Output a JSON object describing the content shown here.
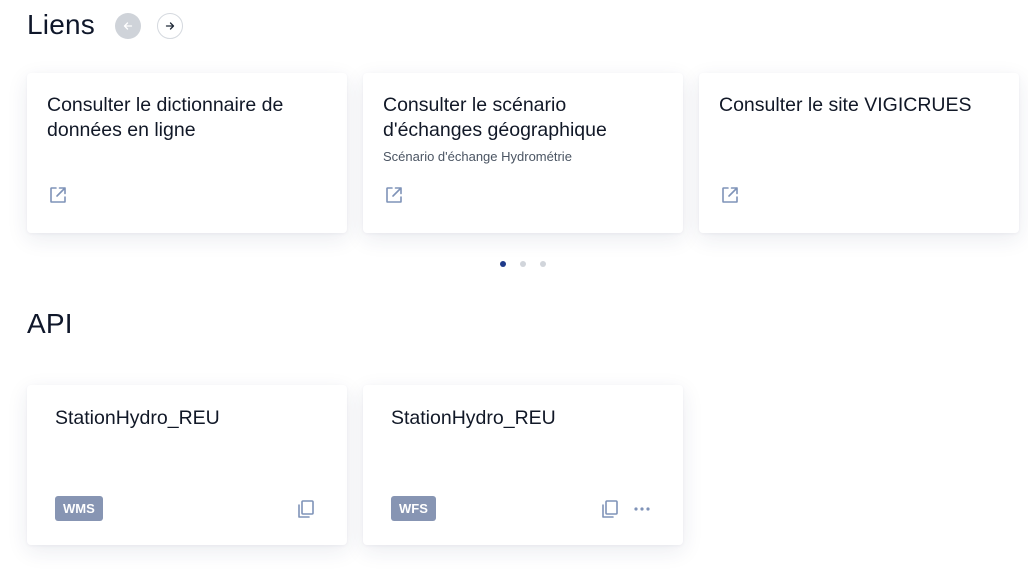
{
  "links_section": {
    "title": "Liens",
    "prev_icon": "arrow-left-icon",
    "next_icon": "arrow-right-icon",
    "cards": [
      {
        "title": "Consulter le dictionnaire de données en ligne",
        "subtitle": "",
        "icon": "external-link-icon"
      },
      {
        "title": "Consulter le scénario d'échanges géographique",
        "subtitle": "Scénario d'échange Hydrométrie",
        "icon": "external-link-icon"
      },
      {
        "title": "Consulter le site VIGICRUES",
        "subtitle": "",
        "icon": "external-link-icon"
      }
    ],
    "pagination": {
      "total": 3,
      "active": 1
    }
  },
  "api_section": {
    "title": "API",
    "cards": [
      {
        "title": "StationHydro_REU",
        "badge": "WMS",
        "icons": [
          "copy-icon"
        ]
      },
      {
        "title": "StationHydro_REU",
        "badge": "WFS",
        "icons": [
          "copy-icon",
          "more-icon"
        ]
      }
    ]
  },
  "colors": {
    "badge_bg": "#8795b3",
    "icon_blue": "#7f93b8",
    "active_dot": "#1e3a8a",
    "inactive_dot": "#d1d5db"
  }
}
